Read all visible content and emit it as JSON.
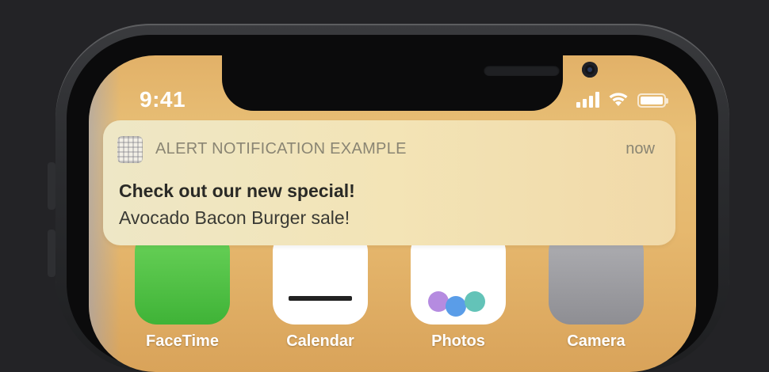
{
  "status_bar": {
    "time": "9:41",
    "signal_icon": "cellular-signal-icon",
    "wifi_icon": "wifi-icon",
    "battery_icon": "battery-icon"
  },
  "notification": {
    "app_icon": "app-icon",
    "app_name": "ALERT NOTIFICATION EXAMPLE",
    "time": "now",
    "title": "Check out our new special!",
    "body": "Avocado Bacon Burger sale!"
  },
  "home_apps": [
    {
      "label": "FaceTime",
      "color": "#55c548"
    },
    {
      "label": "Calendar",
      "color": "#ffffff"
    },
    {
      "label": "Photos",
      "color": "#ffffff"
    },
    {
      "label": "Camera",
      "color": "#9a9a9e"
    }
  ],
  "colors": {
    "background": "#232326",
    "wallpaper": "#e6b86e",
    "notification_bg": "#f2e2b4"
  }
}
